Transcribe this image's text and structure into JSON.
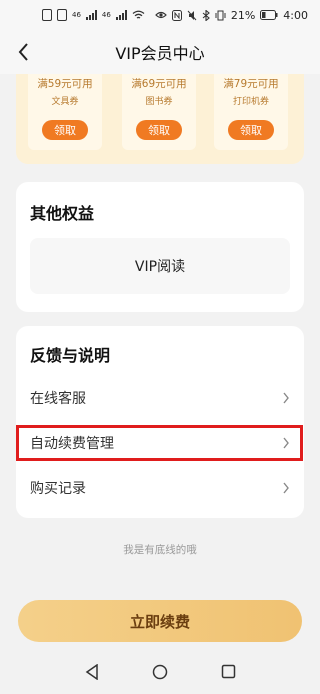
{
  "status_bar": {
    "carriers": [
      "46",
      "46"
    ],
    "battery": "21%",
    "time": "4:00"
  },
  "header": {
    "title": "VIP会员中心",
    "back_icon": "chevron-left-icon"
  },
  "coupons": [
    {
      "condition": "满59元可用",
      "type": "文具券",
      "button": "领取"
    },
    {
      "condition": "满69元可用",
      "type": "图书券",
      "button": "领取"
    },
    {
      "condition": "满79元可用",
      "type": "打印机券",
      "button": "领取"
    }
  ],
  "rights": {
    "title": "其他权益",
    "item": "VIP阅读"
  },
  "feedback": {
    "title": "反馈与说明",
    "items": [
      "在线客服",
      "自动续费管理",
      "购买记录"
    ]
  },
  "footer_note": "我是有底线的哦",
  "cta_label": "立即续费",
  "colors": {
    "accent": "#f07a22",
    "highlight": "#e01d1d",
    "cta": "#f2c97d"
  }
}
